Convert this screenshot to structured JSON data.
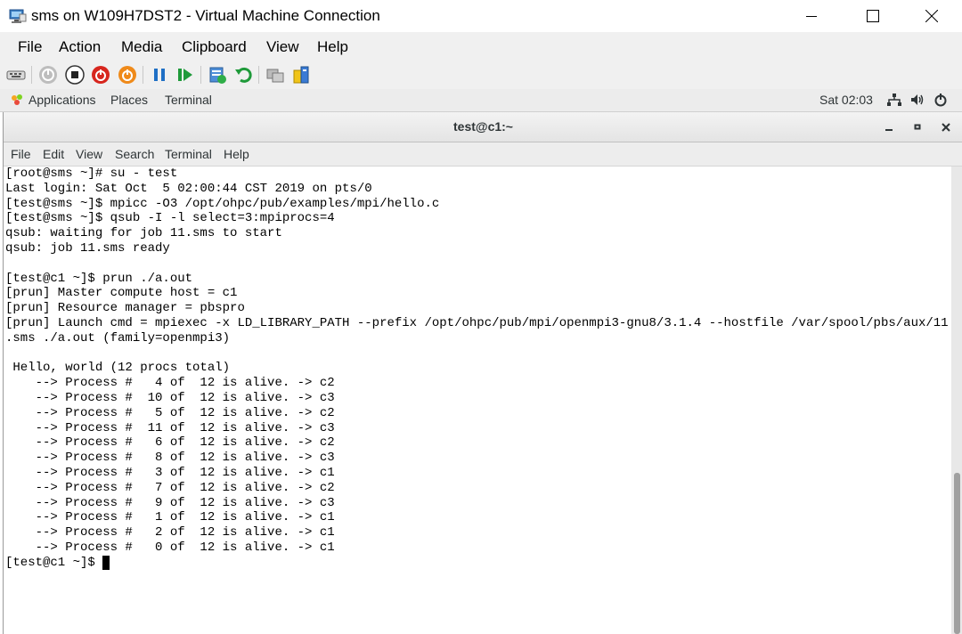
{
  "window": {
    "title": "sms on W109H7DST2 - Virtual Machine Connection",
    "menu": [
      "File",
      "Action",
      "Media",
      "Clipboard",
      "View",
      "Help"
    ],
    "toolbar_icons": [
      "ctrl-alt-del-icon",
      "start-icon",
      "turn-off-icon",
      "shut-down-icon",
      "power-reset-icon",
      "pause-icon",
      "resume-icon",
      "checkpoint-icon",
      "revert-icon",
      "enhanced-session-icon",
      "settings-icon"
    ]
  },
  "gnome": {
    "applications": "Applications",
    "places": "Places",
    "terminal": "Terminal",
    "clock": "Sat 02:03"
  },
  "terminal": {
    "title": "test@c1:~",
    "menu": [
      "File",
      "Edit",
      "View",
      "Search",
      "Terminal",
      "Help"
    ],
    "lines": [
      "[root@sms ~]# su - test",
      "Last login: Sat Oct  5 02:00:44 CST 2019 on pts/0",
      "[test@sms ~]$ mpicc -O3 /opt/ohpc/pub/examples/mpi/hello.c",
      "[test@sms ~]$ qsub -I -l select=3:mpiprocs=4",
      "qsub: waiting for job 11.sms to start",
      "qsub: job 11.sms ready",
      "",
      "[test@c1 ~]$ prun ./a.out",
      "[prun] Master compute host = c1",
      "[prun] Resource manager = pbspro",
      "[prun] Launch cmd = mpiexec -x LD_LIBRARY_PATH --prefix /opt/ohpc/pub/mpi/openmpi3-gnu8/3.1.4 --hostfile /var/spool/pbs/aux/11",
      ".sms ./a.out (family=openmpi3)",
      "",
      " Hello, world (12 procs total)",
      "    --> Process #   4 of  12 is alive. -> c2",
      "    --> Process #  10 of  12 is alive. -> c3",
      "    --> Process #   5 of  12 is alive. -> c2",
      "    --> Process #  11 of  12 is alive. -> c3",
      "    --> Process #   6 of  12 is alive. -> c2",
      "    --> Process #   8 of  12 is alive. -> c3",
      "    --> Process #   3 of  12 is alive. -> c1",
      "    --> Process #   7 of  12 is alive. -> c2",
      "    --> Process #   9 of  12 is alive. -> c3",
      "    --> Process #   1 of  12 is alive. -> c1",
      "    --> Process #   2 of  12 is alive. -> c1",
      "    --> Process #   0 of  12 is alive. -> c1"
    ],
    "prompt": "[test@c1 ~]$ "
  }
}
